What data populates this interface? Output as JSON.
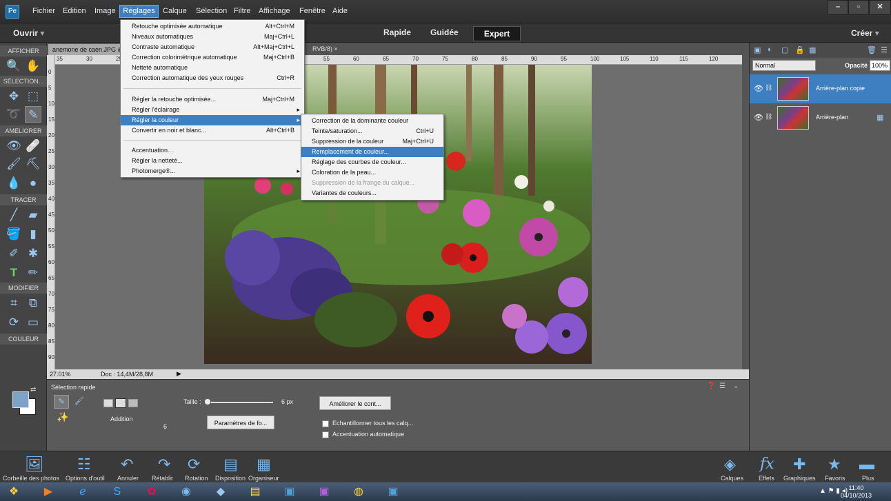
{
  "app": {
    "icon": "pse-app-icon"
  },
  "menubar": {
    "items": [
      "Fichier",
      "Edition",
      "Image",
      "Réglages",
      "Calque",
      "Sélection",
      "Filtre",
      "Affichage",
      "Fenêtre",
      "Aide"
    ]
  },
  "window_controls": {
    "minimize": "–",
    "maximize": "▫",
    "close": "✕"
  },
  "modebar": {
    "open_label": "Ouvrir",
    "open_arrow": "▾",
    "modes": [
      "Rapide",
      "Guidée",
      "Expert"
    ],
    "active_mode": "Expert",
    "create_label": "Créer",
    "create_arrow": "▾"
  },
  "toolbox": {
    "sections": [
      "AFFICHER",
      "SÉLECTION...",
      "AMELIORER",
      "TRACER",
      "MODIFIER",
      "COULEUR"
    ]
  },
  "document": {
    "tab_title": "anemone de caen.JPG @",
    "tab_suffix": "RVB/8) ×",
    "zoom": "27.01%",
    "doc_size": "Doc : 14,4M/28,8M",
    "ruler_h": [
      "35",
      "30",
      "25",
      "25",
      "30",
      "35",
      "40",
      "45",
      "50",
      "55",
      "60",
      "65",
      "70",
      "75",
      "80",
      "85",
      "90",
      "95",
      "100",
      "105",
      "110",
      "115",
      "120"
    ],
    "ruler_v": [
      "0",
      "5",
      "10",
      "15",
      "20",
      "25",
      "30",
      "35",
      "40",
      "45",
      "50",
      "55",
      "60",
      "65",
      "70",
      "75",
      "80",
      "85",
      "90"
    ]
  },
  "menu_reglages": {
    "items": [
      {
        "label": "Retouche optimisée automatique",
        "shortcut": "Alt+Ctrl+M"
      },
      {
        "label": "Niveaux automatiques",
        "shortcut": "Maj+Ctrl+L"
      },
      {
        "label": "Contraste automatique",
        "shortcut": "Alt+Maj+Ctrl+L"
      },
      {
        "label": "Correction colorimétrique automatique",
        "shortcut": "Maj+Ctrl+B"
      },
      {
        "label": "Netteté automatique",
        "shortcut": ""
      },
      {
        "label": "Correction automatique des yeux rouges",
        "shortcut": "Ctrl+R"
      },
      {
        "label": "Régler la retouche optimisée...",
        "shortcut": "Maj+Ctrl+M"
      },
      {
        "label": "Régler l'éclairage",
        "shortcut": "▸"
      },
      {
        "label": "Régler la couleur",
        "shortcut": "▸"
      },
      {
        "label": "Convertir en noir et blanc...",
        "shortcut": "Alt+Ctrl+B"
      },
      {
        "label": "Accentuation...",
        "shortcut": ""
      },
      {
        "label": "Régler la netteté...",
        "shortcut": ""
      },
      {
        "label": "Photomerge®...",
        "shortcut": "▸"
      }
    ]
  },
  "submenu_couleur": {
    "items": [
      {
        "label": "Correction de la dominante couleur",
        "shortcut": ""
      },
      {
        "label": "Teinte/saturation...",
        "shortcut": "Ctrl+U"
      },
      {
        "label": "Suppression de la couleur",
        "shortcut": "Maj+Ctrl+U"
      },
      {
        "label": "Remplacement de couleur...",
        "shortcut": ""
      },
      {
        "label": "Réglage des courbes de couleur...",
        "shortcut": ""
      },
      {
        "label": "Coloration de la peau...",
        "shortcut": ""
      },
      {
        "label": "Suppression de la frange du calque...",
        "shortcut": ""
      },
      {
        "label": "Variantes de couleurs...",
        "shortcut": ""
      }
    ]
  },
  "options": {
    "tool_name": "Sélection rapide",
    "mode_label": "Addition",
    "size_label": "Taille :",
    "size_value": "6 px",
    "brush_size": "6",
    "brush_settings": "Paramètres de fo...",
    "refine": "Améliorer le cont...",
    "sample_all": "Echantillonner tous les calq...",
    "auto_enhance": "Accentuation automatique"
  },
  "layers_panel": {
    "blend_mode": "Normal",
    "opacity_label": "Opacité :",
    "opacity_value": "100%",
    "layers": [
      {
        "name": "Arrière-plan copie",
        "selected": true
      },
      {
        "name": "Arrière-plan",
        "selected": false
      }
    ]
  },
  "bottombar": {
    "left": [
      "Corbeille des photos",
      "Options d'outil",
      "Annuler",
      "Rétablir",
      "Rotation",
      "Disposition",
      "Organiseur"
    ],
    "right": [
      "Calques",
      "Effets",
      "Graphiques",
      "Favoris",
      "Plus"
    ]
  },
  "taskbar": {
    "time": "11:40",
    "date": "04/10/2013"
  },
  "colors": {
    "accent": "#3d7fc1",
    "foreground_swatch": "#7ea3c8",
    "background_swatch": "#ffffff"
  }
}
